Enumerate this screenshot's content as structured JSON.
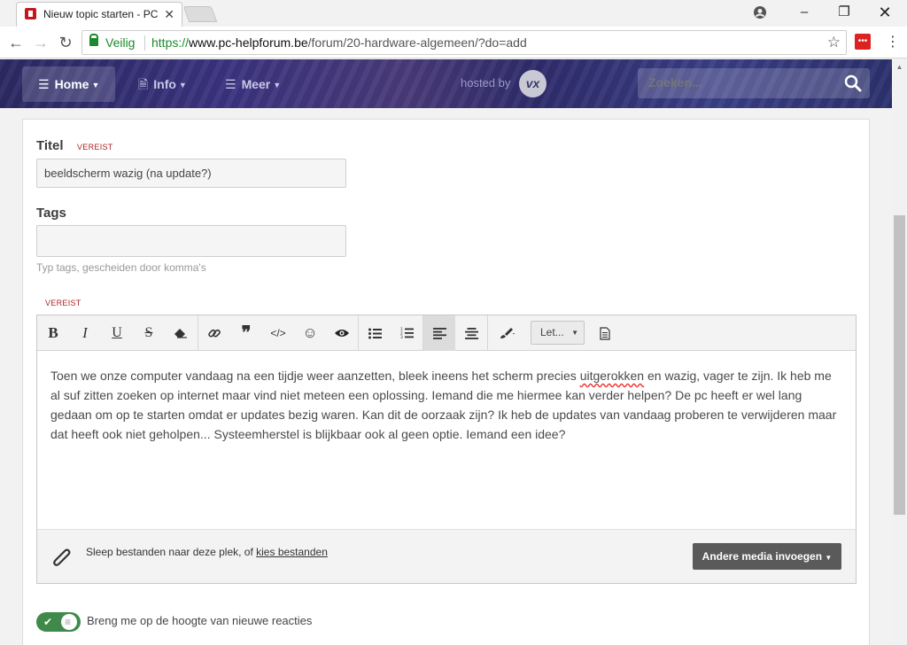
{
  "browser": {
    "tab_title": "Nieuw topic starten - PC",
    "secure_label": "Veilig",
    "url_scheme": "https://",
    "url_host": "www.pc-helpforum.be",
    "url_path": "/forum/20-hardware-algemeen/?do=add"
  },
  "header": {
    "nav": [
      {
        "label": "Home"
      },
      {
        "label": "Info"
      },
      {
        "label": "Meer"
      }
    ],
    "hosted_by": "hosted by",
    "search_placeholder": "Zoeken..."
  },
  "form": {
    "title_label": "Titel",
    "required_label": "VEREIST",
    "title_value": "beeldscherm wazig (na update?)",
    "tags_label": "Tags",
    "tags_value": "",
    "tags_hint": "Typ tags, gescheiden door komma's",
    "body_required_label": "VEREIST"
  },
  "editor": {
    "font_select": "Let...",
    "body_before": "Toen we onze computer vandaag na een tijdje weer aanzetten, bleek ineens het scherm precies ",
    "body_misspelled": "uitgerokken",
    "body_after": " en wazig, vager te zijn. Ik heb me al suf zitten zoeken op internet maar vind niet meteen een oplossing. Iemand die me hiermee kan verder helpen? De pc heeft er wel lang gedaan om op te starten omdat er updates bezig waren. Kan dit de oorzaak zijn? Ik heb de updates van vandaag proberen te verwijderen maar dat heeft ook niet geholpen... Systeemherstel is blijkbaar ook al geen optie. Iemand een idee?",
    "attach_text": "Sleep bestanden naar deze plek, of ",
    "attach_link": "kies bestanden",
    "media_button": "Andere media invoegen"
  },
  "notify": {
    "label": "Breng me op de hoogte van nieuwe reacties",
    "enabled": true
  },
  "colors": {
    "accent_green": "#3f8a4a",
    "required_red": "#b22222",
    "header_purple": "#3b3380"
  }
}
